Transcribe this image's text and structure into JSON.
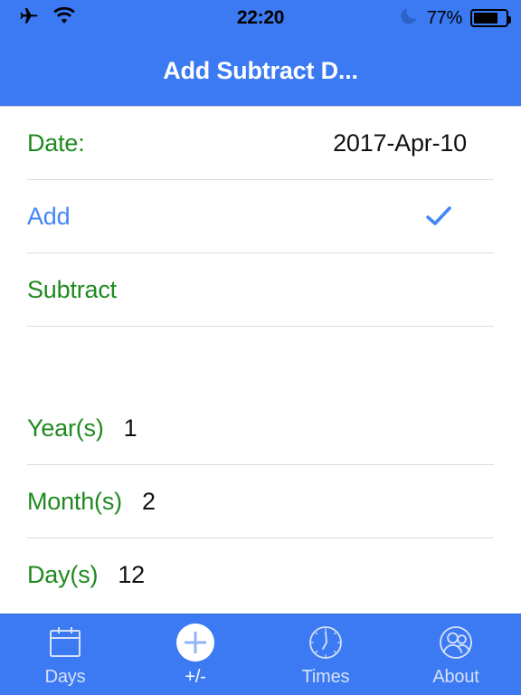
{
  "status_bar": {
    "airplane_icon": "airplane-mode-icon",
    "wifi_icon": "wifi-icon",
    "time": "22:20",
    "moon_icon": "do-not-disturb-moon-icon",
    "battery_percent": "77%",
    "battery_level": 77,
    "battery_icon": "battery-icon"
  },
  "nav_bar": {
    "title": "Add Subtract D...",
    "background": "#3b7af2",
    "title_color": "#ffffff"
  },
  "colors": {
    "brand_blue": "#3b7af2",
    "label_green": "#1f8a1f",
    "selected_blue": "#4285f4",
    "value_black": "#111111",
    "separator": "#dcdcdc"
  },
  "form": {
    "date_row": {
      "label": "Date:",
      "value": "2017-Apr-10"
    },
    "mode_options": [
      {
        "label": "Add",
        "selected": true,
        "check_icon": "checkmark-icon"
      },
      {
        "label": "Subtract",
        "selected": false
      }
    ],
    "duration_rows": [
      {
        "label": "Year(s)",
        "value": "1"
      },
      {
        "label": "Month(s)",
        "value": "2"
      },
      {
        "label": "Day(s)",
        "value": "12"
      }
    ]
  },
  "tab_bar": {
    "items": [
      {
        "label": "Days",
        "icon": "calendar-icon",
        "active": false
      },
      {
        "label": "+/-",
        "icon": "plus-circle-icon",
        "active": true
      },
      {
        "label": "Times",
        "icon": "clock-icon",
        "active": false
      },
      {
        "label": "About",
        "icon": "people-icon",
        "active": false
      }
    ]
  }
}
